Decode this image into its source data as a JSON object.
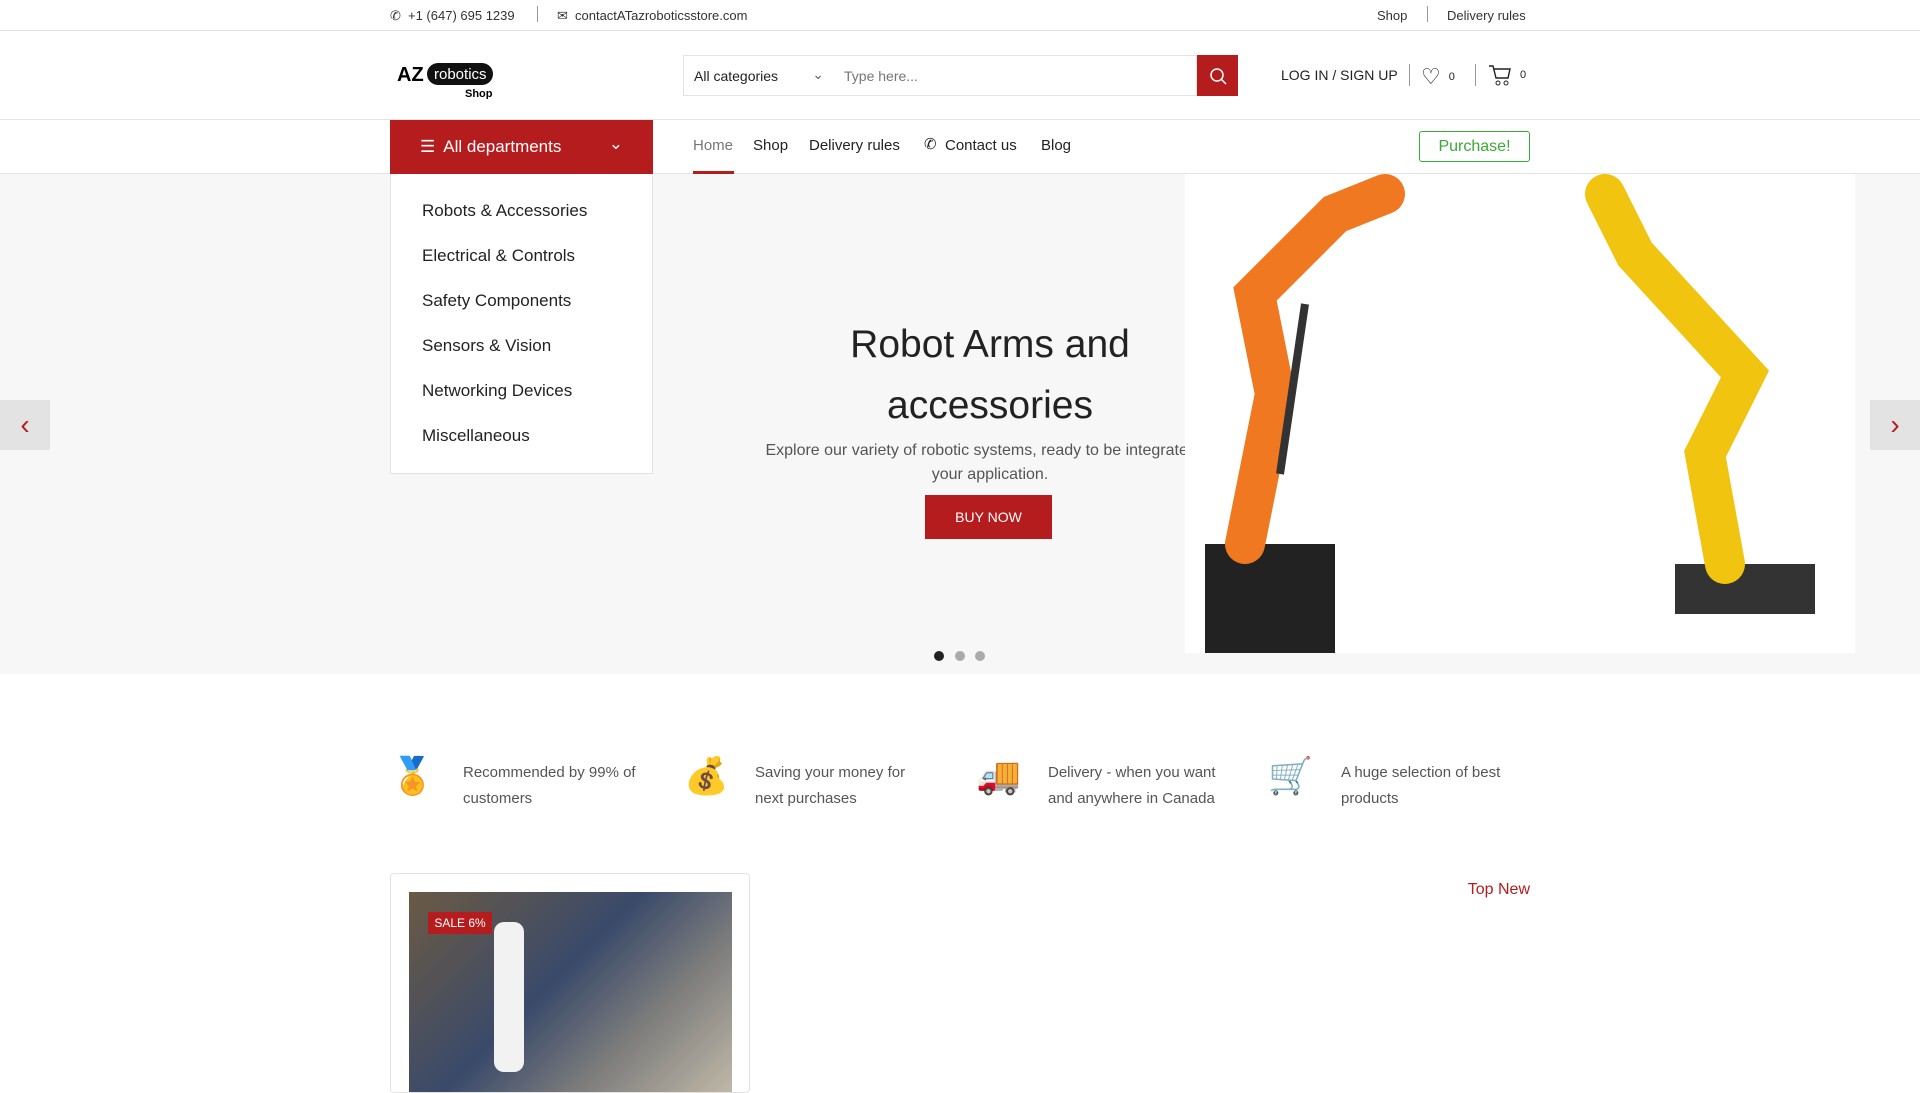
{
  "topbar": {
    "phone": "+1 (647) 695 1239",
    "email": "contactATazroboticsstore.com",
    "links": [
      "Shop",
      "Delivery rules"
    ]
  },
  "header": {
    "logo_text": "AZ robotics Shop",
    "category_select": "All categories",
    "search_placeholder": "Type here...",
    "login": "LOG IN / SIGN UP",
    "wishlist_count": "0",
    "cart_count": "0"
  },
  "nav": {
    "departments": "All departments",
    "items": [
      "Home",
      "Shop",
      "Delivery rules",
      "Contact us",
      "Blog"
    ],
    "purchase": "Purchase!"
  },
  "departments": [
    "Robots & Accessories",
    "Electrical & Controls",
    "Safety Components",
    "Sensors & Vision",
    "Networking Devices",
    "Miscellaneous"
  ],
  "hero": {
    "title_line1": "Robot Arms and",
    "title_line2": "accessories",
    "subtitle_line1": "Explore our variety of robotic systems, ready to be integrated to",
    "subtitle_line2": "your application.",
    "cta": "BUY NOW",
    "active_slide": 1,
    "slides": 3
  },
  "features": [
    {
      "icon": "award-icon",
      "line1": "Recommended by 99% of",
      "line2": "customers"
    },
    {
      "icon": "money-bag-icon",
      "line1": "Saving your money for",
      "line2": "next purchases"
    },
    {
      "icon": "delivery-truck-icon",
      "line1": "Delivery - when you want",
      "line2": "and anywhere in Canada"
    },
    {
      "icon": "shopping-cart-icon",
      "line1": "A huge selection of best",
      "line2": "products"
    }
  ],
  "products": {
    "tab": "Top New",
    "items": [
      {
        "badge": "SALE 6%"
      }
    ]
  },
  "colors": {
    "accent": "#b51c1e",
    "purchase": "#3aaa35"
  }
}
